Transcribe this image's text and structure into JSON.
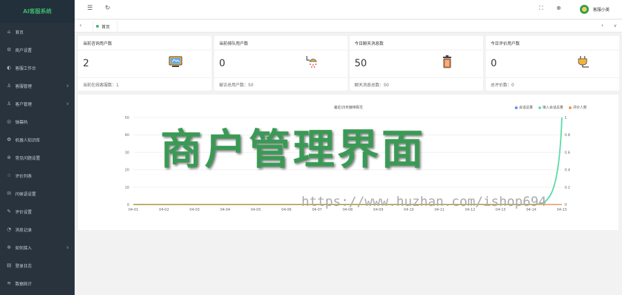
{
  "app": {
    "logo": "AI客服系统"
  },
  "sidebar": {
    "items": [
      {
        "label": "首页",
        "icon": "home-icon",
        "glyph": "⌂",
        "arrow": ""
      },
      {
        "label": "商户设置",
        "icon": "gear-icon",
        "glyph": "⚙",
        "arrow": ""
      },
      {
        "label": "客服工作台",
        "icon": "headset-icon",
        "glyph": "◐",
        "arrow": ""
      },
      {
        "label": "客服管理",
        "icon": "user-icon",
        "glyph": "♙",
        "arrow": "∨"
      },
      {
        "label": "客户管理",
        "icon": "users-icon",
        "glyph": "♙",
        "arrow": "∨"
      },
      {
        "label": "弹幕码",
        "icon": "qrcode-icon",
        "glyph": "◎",
        "arrow": ""
      },
      {
        "label": "机器人知识库",
        "icon": "robot-icon",
        "glyph": "✿",
        "arrow": ""
      },
      {
        "label": "常见问题设置",
        "icon": "question-icon",
        "glyph": "⊛",
        "arrow": ""
      },
      {
        "label": "评价列表",
        "icon": "star-icon",
        "glyph": "☆",
        "arrow": ""
      },
      {
        "label": "问候语设置",
        "icon": "message-icon",
        "glyph": "✉",
        "arrow": ""
      },
      {
        "label": "评价设置",
        "icon": "edit-icon",
        "glyph": "✎",
        "arrow": ""
      },
      {
        "label": "消息记录",
        "icon": "record-icon",
        "glyph": "◔",
        "arrow": ""
      },
      {
        "label": "如何接入",
        "icon": "plug-icon",
        "glyph": "⊕",
        "arrow": "∨"
      },
      {
        "label": "登录日志",
        "icon": "log-icon",
        "glyph": "▤",
        "arrow": ""
      },
      {
        "label": "数据统计",
        "icon": "stats-icon",
        "glyph": "≋",
        "arrow": ""
      }
    ]
  },
  "topbar": {
    "menu_glyph": "☰",
    "refresh_glyph": "↻",
    "fullscreen_glyph": "⛶",
    "lang_glyph": "⊕",
    "user_name": "客服小美"
  },
  "tabs": {
    "prev": "‹",
    "next": "›",
    "more": "∨",
    "items": [
      {
        "label": "首页"
      }
    ]
  },
  "cards": [
    {
      "title": "当前咨询用户数",
      "value": "2",
      "footer": "当前在线客服数：1",
      "icon": "monitor-icon"
    },
    {
      "title": "当前排队用户数",
      "value": "0",
      "footer": "被访总用户数：50",
      "icon": "shower-icon"
    },
    {
      "title": "今日聊天消息数",
      "value": "50",
      "footer": "聊天消息总数：50",
      "icon": "trash-icon"
    },
    {
      "title": "今日评价用户数",
      "value": "0",
      "footer": "总评价数：0",
      "icon": "plug-icon"
    }
  ],
  "chart": {
    "title": "最近15天接待情况",
    "legend": [
      {
        "name": "会话总量",
        "color": "#5b8ff9"
      },
      {
        "name": "接入会话总量",
        "color": "#61ddaa"
      },
      {
        "name": "评价人数",
        "color": "#f6903d"
      }
    ]
  },
  "chart_data": {
    "type": "line",
    "title": "最近15天接待情况",
    "categories": [
      "04-01",
      "04-02",
      "04-03",
      "04-04",
      "04-05",
      "04-06",
      "04-07",
      "04-08",
      "04-09",
      "04-10",
      "04-11",
      "04-12",
      "04-13",
      "04-14",
      "04-15"
    ],
    "y_left": {
      "ticks": [
        0,
        10,
        20,
        30,
        40,
        50
      ],
      "range": [
        0,
        50
      ]
    },
    "y_right": {
      "ticks": [
        0,
        0.2,
        0.4,
        0.6,
        0.8,
        1
      ],
      "range": [
        0,
        1
      ]
    },
    "series": [
      {
        "name": "会话总量",
        "color": "#5b8ff9",
        "values": [
          0,
          0,
          0,
          0,
          0,
          0,
          0,
          0,
          0,
          0,
          0,
          0,
          0,
          0,
          0
        ]
      },
      {
        "name": "接入会话总量",
        "color": "#61ddaa",
        "values": [
          0,
          0,
          0,
          0,
          0,
          0,
          0,
          0,
          0,
          0,
          0,
          0,
          0,
          0,
          50
        ]
      },
      {
        "name": "评价人数",
        "color": "#f6903d",
        "values": [
          0,
          0,
          0,
          0,
          0,
          0,
          0,
          0,
          0,
          0,
          0,
          0,
          0,
          0,
          0
        ]
      }
    ]
  },
  "overlay": {
    "title": "商户管理界面",
    "watermark": "https://www.huzhan.com/ishop694"
  }
}
